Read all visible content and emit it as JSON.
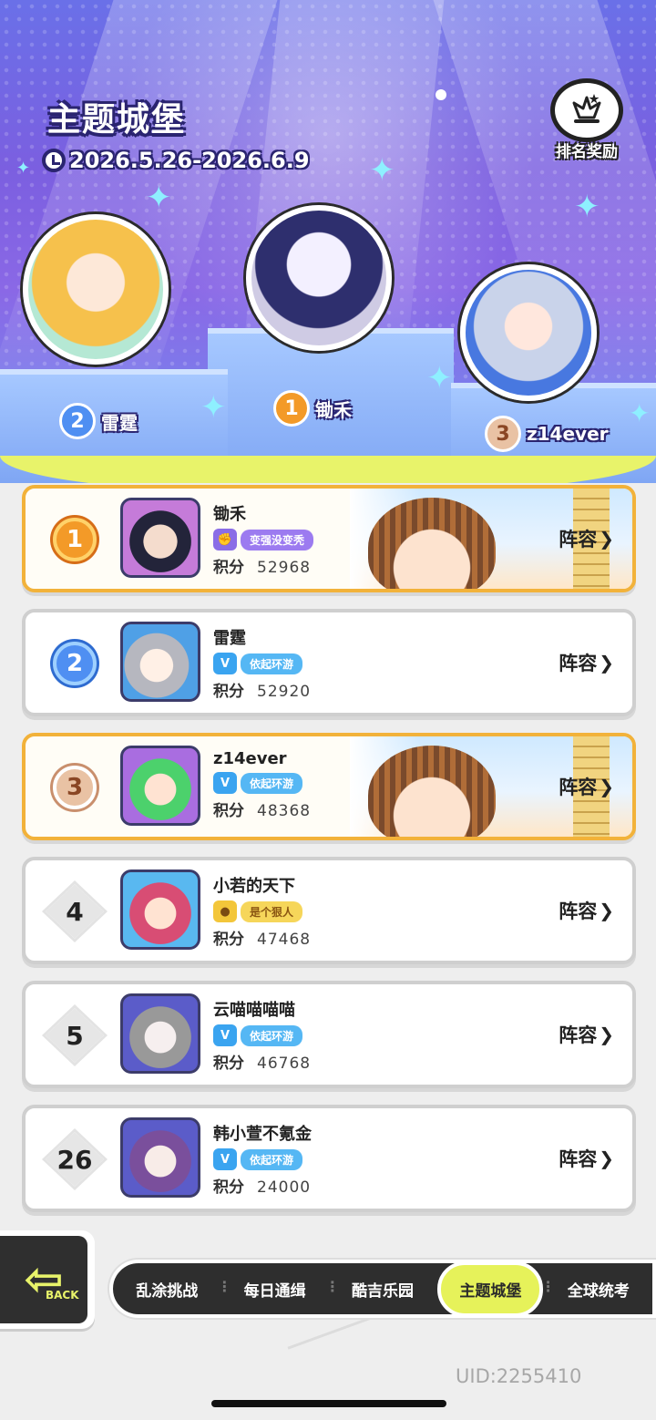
{
  "header": {
    "title": "主题城堡",
    "date_range": "2026.5.26-2026.6.9",
    "reward_label": "排名奖励"
  },
  "podium": [
    {
      "rank": "1",
      "name": "锄禾",
      "color": "#f39a28"
    },
    {
      "rank": "2",
      "name": "雷霆",
      "color": "#4f8ff2"
    },
    {
      "rank": "3",
      "name": "z14ever",
      "color": "#e9c2a4"
    }
  ],
  "ranking": {
    "score_label": "积分",
    "lineup_label": "阵容",
    "rows": [
      {
        "rank": "1",
        "name": "锄禾",
        "tag": "变强没变秃",
        "score": "52968"
      },
      {
        "rank": "2",
        "name": "雷霆",
        "tag": "依起环游",
        "score": "52920"
      },
      {
        "rank": "3",
        "name": "z14ever",
        "tag": "依起环游",
        "score": "48368"
      },
      {
        "rank": "4",
        "name": "小若的天下",
        "tag": "是个狠人",
        "score": "47468"
      },
      {
        "rank": "5",
        "name": "云喵喵喵喵",
        "tag": "依起环游",
        "score": "46768"
      },
      {
        "rank": "26",
        "name": "韩小萱不氪金",
        "tag": "依起环游",
        "score": "24000"
      }
    ]
  },
  "nav": {
    "back_label": "BACK",
    "tabs": [
      "乱涂挑战",
      "每日通缉",
      "酷吉乐园",
      "主题城堡",
      "全球统考"
    ],
    "active_tab": "主题城堡"
  },
  "footer": {
    "uid": "UID:2255410"
  },
  "colors": {
    "accent_yellow": "#e6f25a",
    "gold_border": "#f2b23a",
    "stage_purple": "#7b5fe0"
  }
}
